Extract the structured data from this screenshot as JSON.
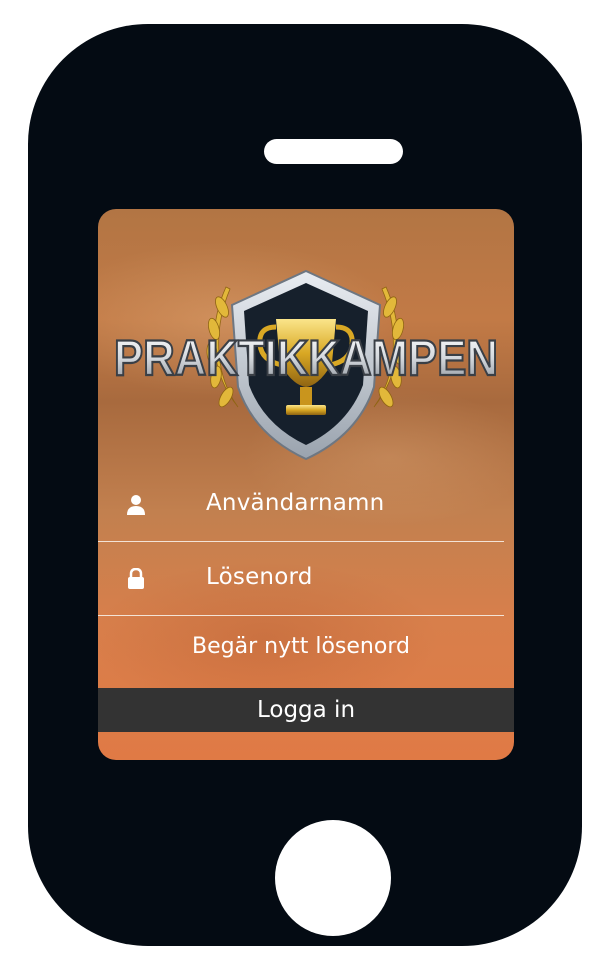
{
  "logo": {
    "text": "PRAKTIKKAMPEN"
  },
  "login_form": {
    "username_placeholder": "Användarnamn",
    "password_placeholder": "Lösenord",
    "forgot_password_label": "Begär nytt lösenord",
    "login_button_label": "Logga in"
  },
  "icons": {
    "username": "user-icon",
    "password": "lock-icon"
  },
  "colors": {
    "phone_body": "#040b13",
    "screen_background": "#c27a46",
    "login_button": "#333333",
    "text": "#ffffff"
  }
}
